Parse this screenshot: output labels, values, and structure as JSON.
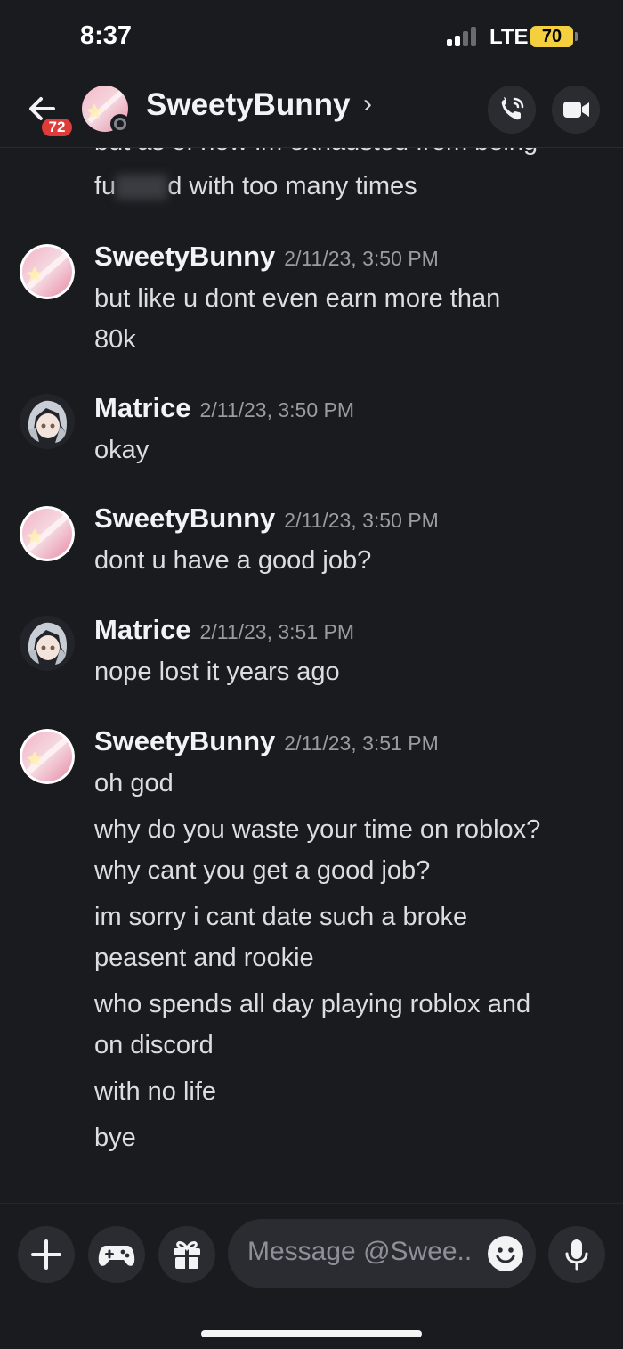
{
  "status": {
    "time": "8:37",
    "network": "LTE",
    "battery": "70"
  },
  "header": {
    "unread_count": "72",
    "name": "SweetyBunny",
    "chevron": "›",
    "icons": {
      "back": "back-arrow-icon",
      "call": "phone-call-icon",
      "video": "video-camera-icon"
    }
  },
  "cutoff_message": {
    "line_top": "but as of now im exhausted from being",
    "line_prefix": "fu",
    "line_suffix": "d with too many times"
  },
  "messages": [
    {
      "author": "SweetyBunny",
      "timestamp": "2/11/23, 3:50 PM",
      "lines": [
        "but like u dont even earn more than",
        "80k"
      ]
    },
    {
      "author": "Matrice",
      "timestamp": "2/11/23, 3:50 PM",
      "lines": [
        "okay"
      ]
    },
    {
      "author": "SweetyBunny",
      "timestamp": "2/11/23, 3:50 PM",
      "lines": [
        "dont u have a good job?"
      ]
    },
    {
      "author": "Matrice",
      "timestamp": "2/11/23, 3:51 PM",
      "lines": [
        "nope lost it years ago"
      ]
    },
    {
      "author": "SweetyBunny",
      "timestamp": "2/11/23, 3:51 PM",
      "lines": [
        "oh god",
        "why do you waste your time on roblox?",
        "why cant you get a good job?",
        "im sorry i cant date such a broke",
        "peasent and rookie",
        "who spends all day playing roblox and",
        "on discord",
        "with no life",
        "bye"
      ]
    }
  ],
  "composer": {
    "placeholder": "Message @Swee..",
    "icons": {
      "add": "plus-icon",
      "games": "gamepad-icon",
      "gift": "gift-icon",
      "emoji": "emoji-icon",
      "voice": "microphone-icon"
    }
  },
  "colors": {
    "background": "#1a1b1f",
    "text": "#dbdee1",
    "badge": "#e03b3b",
    "battery": "#f4d03f"
  }
}
